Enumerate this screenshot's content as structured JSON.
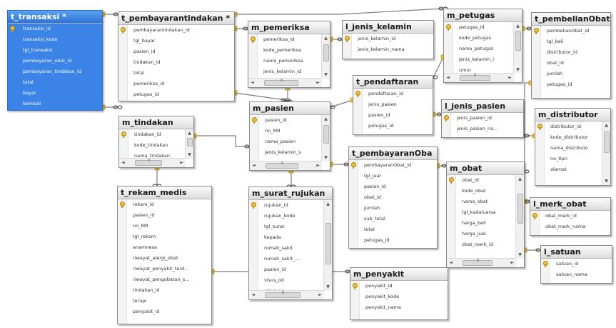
{
  "tables": [
    {
      "id": "t_transaksi",
      "title": "t_transaksi *",
      "selected": true,
      "columns": [
        {
          "name": "transaksi_id",
          "pk": true
        },
        {
          "name": "transaksi_kode"
        },
        {
          "name": "tgl_transaksi"
        },
        {
          "name": "pembayaran_obat_id"
        },
        {
          "name": "pembayaran_tindakan_id"
        },
        {
          "name": "total"
        },
        {
          "name": "bayar"
        },
        {
          "name": "kembali"
        }
      ]
    },
    {
      "id": "t_pembayarantindakan",
      "title": "t_pembayarantindakan *",
      "columns": [
        {
          "name": "pembayarantindakan_id",
          "pk": true
        },
        {
          "name": "tgl_bayar"
        },
        {
          "name": "pasien_id"
        },
        {
          "name": "tindakan_id"
        },
        {
          "name": "total"
        },
        {
          "name": "pemeriksa_id"
        },
        {
          "name": "petugas_id"
        }
      ]
    },
    {
      "id": "m_pemeriksa",
      "title": "m_pemeriksa",
      "columns": [
        {
          "name": "pemeriksa_id",
          "pk": true
        },
        {
          "name": "kode_pemeriksa"
        },
        {
          "name": "nama_pemeriksa"
        },
        {
          "name": "jenis_kelamin_id"
        }
      ]
    },
    {
      "id": "l_jenis_kelamin",
      "title": "l_jenis_kelamin",
      "columns": [
        {
          "name": "jenis_kelamin_id",
          "pk": true
        },
        {
          "name": "jenis_kelamin_nama"
        }
      ]
    },
    {
      "id": "m_petugas",
      "title": "m_petugas",
      "columns": [
        {
          "name": "petugas_id",
          "pk": true
        },
        {
          "name": "kode_petugas"
        },
        {
          "name": "nama_petugas"
        },
        {
          "name": "jenis_kelamin_i"
        },
        {
          "name": "umur"
        }
      ]
    },
    {
      "id": "t_pembelianObat",
      "title": "t_pembelianObat",
      "columns": [
        {
          "name": "pembelianObat_id",
          "pk": true
        },
        {
          "name": "tgl_beli"
        },
        {
          "name": "distributor_id"
        },
        {
          "name": "obat_id"
        },
        {
          "name": "jumlah"
        },
        {
          "name": "petugas_id"
        }
      ]
    },
    {
      "id": "t_pendaftaran",
      "title": "t_pendaftaran",
      "columns": [
        {
          "name": "pendaftaran_id",
          "pk": true
        },
        {
          "name": "jenis_pasien"
        },
        {
          "name": "pasien_id"
        },
        {
          "name": "petugas_id"
        }
      ]
    },
    {
      "id": "l_jenis_pasien",
      "title": "l_jenis_pasien",
      "columns": [
        {
          "name": "jenis_pasien_id",
          "pk": true
        },
        {
          "name": "jenis_pasien_na..."
        }
      ]
    },
    {
      "id": "m_distributor",
      "title": "m_distributor",
      "columns": [
        {
          "name": "distributor_id",
          "pk": true
        },
        {
          "name": "kode_distributor"
        },
        {
          "name": "nama_distributo"
        },
        {
          "name": "no_tlpn"
        },
        {
          "name": "alamat"
        }
      ]
    },
    {
      "id": "m_tindakan",
      "title": "m_tindakan",
      "columns": [
        {
          "name": "tindakan_id",
          "pk": true
        },
        {
          "name": "kode_tindakan"
        },
        {
          "name": "nama_tindakan"
        }
      ]
    },
    {
      "id": "m_pasien",
      "title": "m_pasien",
      "columns": [
        {
          "name": "pasien_id",
          "pk": true
        },
        {
          "name": "no_RM"
        },
        {
          "name": "nama_pasien"
        },
        {
          "name": "jenis_kelamin_s"
        }
      ]
    },
    {
      "id": "t_pembayaranObat",
      "title": "t_pembayaranOba",
      "columns": [
        {
          "name": "pembayaranObat_id",
          "pk": true
        },
        {
          "name": "tgl_jual"
        },
        {
          "name": "pasien_id"
        },
        {
          "name": "obat_id"
        },
        {
          "name": "jumlah"
        },
        {
          "name": "sub_total"
        },
        {
          "name": "total"
        },
        {
          "name": "petugas_id"
        }
      ]
    },
    {
      "id": "m_obat",
      "title": "m_obat",
      "columns": [
        {
          "name": "obat_id",
          "pk": true
        },
        {
          "name": "kode_obat"
        },
        {
          "name": "nama_obat"
        },
        {
          "name": "tgl_kadaluarsa"
        },
        {
          "name": "harga_beli"
        },
        {
          "name": "harga_jual"
        },
        {
          "name": "obat_merk_id"
        }
      ]
    },
    {
      "id": "l_merk_obat",
      "title": "l_merk_obat",
      "columns": [
        {
          "name": "obat_merk_id",
          "pk": true
        },
        {
          "name": "obat_merk_nama"
        }
      ]
    },
    {
      "id": "l_satuan",
      "title": "l_satuan",
      "columns": [
        {
          "name": "satuan_id",
          "pk": true
        },
        {
          "name": "satuan_nama"
        }
      ]
    },
    {
      "id": "t_rekam_medis",
      "title": "t_rekam_medis",
      "columns": [
        {
          "name": "rekam_id",
          "pk": true
        },
        {
          "name": "pasien_id"
        },
        {
          "name": "no_RM"
        },
        {
          "name": "tgl_rekam"
        },
        {
          "name": "anamnesa"
        },
        {
          "name": "riwayat_alergi_obat"
        },
        {
          "name": "riwayat_penyakit_terd..."
        },
        {
          "name": "riwayat_pengobatan_s..."
        },
        {
          "name": "tindakan_id"
        },
        {
          "name": "terapi"
        },
        {
          "name": "penyakit_id"
        }
      ]
    },
    {
      "id": "m_surat_rujukan",
      "title": "m_surat_rujukan",
      "columns": [
        {
          "name": "rujukan_id",
          "pk": true
        },
        {
          "name": "rujukan_kode"
        },
        {
          "name": "tgl_surat"
        },
        {
          "name": "kepada"
        },
        {
          "name": "rumah_sakit"
        },
        {
          "name": "rumah_sakit_..."
        },
        {
          "name": "pasien_id"
        },
        {
          "name": "visus_od"
        },
        {
          "name": "visus_os"
        }
      ]
    },
    {
      "id": "m_penyakit",
      "title": "m_penyakit",
      "columns": [
        {
          "name": "penyakit_id",
          "pk": true
        },
        {
          "name": "penyakit_kode"
        },
        {
          "name": "penyakit_nama"
        }
      ]
    }
  ],
  "relationships": [
    {
      "from": "t_transaksi",
      "to": "t_pembayarantindakan"
    },
    {
      "from": "t_transaksi",
      "to": "m_tindakan"
    },
    {
      "from": "t_pembayarantindakan",
      "to": "m_petugas"
    },
    {
      "from": "t_pembayarantindakan",
      "to": "m_pemeriksa"
    },
    {
      "from": "t_pembayarantindakan",
      "to": "m_pasien"
    },
    {
      "from": "m_pemeriksa",
      "to": "l_jenis_kelamin"
    },
    {
      "from": "m_pemeriksa",
      "to": "m_pasien"
    },
    {
      "from": "m_petugas",
      "to": "t_pendaftaran"
    },
    {
      "from": "m_petugas",
      "to": "t_pembelianObat"
    },
    {
      "from": "t_pendaftaran",
      "to": "m_pasien"
    },
    {
      "from": "t_pendaftaran",
      "to": "l_jenis_pasien"
    },
    {
      "from": "m_tindakan",
      "to": "m_pasien"
    },
    {
      "from": "m_tindakan",
      "to": "t_rekam_medis"
    },
    {
      "from": "m_pasien",
      "to": "t_pembayaranObat"
    },
    {
      "from": "m_pasien",
      "to": "m_surat_rujukan"
    },
    {
      "from": "t_pembayaranObat",
      "to": "m_obat"
    },
    {
      "from": "t_pembelianObat",
      "to": "m_obat"
    },
    {
      "from": "m_distributor",
      "to": "t_pembelianObat"
    },
    {
      "from": "m_obat",
      "to": "l_merk_obat"
    },
    {
      "from": "m_obat",
      "to": "l_satuan"
    },
    {
      "from": "t_rekam_medis",
      "to": "m_penyakit"
    }
  ]
}
